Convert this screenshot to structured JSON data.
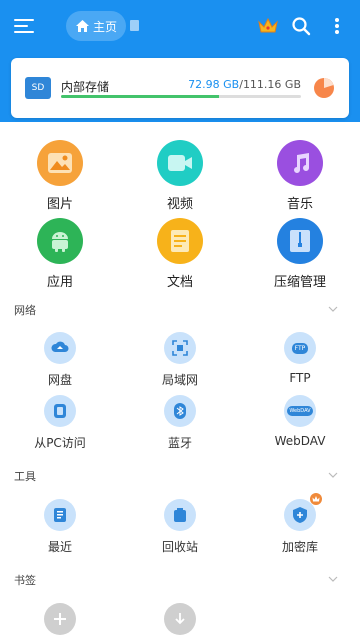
{
  "header": {
    "home_label": "主页"
  },
  "storage": {
    "name": "内部存储",
    "sd_label": "SD",
    "used": "72.98 GB",
    "separator": "/",
    "total": "111.16 GB",
    "used_fraction": 0.66
  },
  "categories": [
    {
      "label": "图片",
      "icon": "image-icon",
      "color": "#f6a23a"
    },
    {
      "label": "视频",
      "icon": "video-icon",
      "color": "#20cdc4"
    },
    {
      "label": "音乐",
      "icon": "music-icon",
      "color": "#9a4fe0"
    },
    {
      "label": "应用",
      "icon": "android-icon",
      "color": "#2db457"
    },
    {
      "label": "文档",
      "icon": "document-icon",
      "color": "#f7b21a"
    },
    {
      "label": "压缩管理",
      "icon": "archive-icon",
      "color": "#2481e0"
    }
  ],
  "sections": {
    "network": {
      "title": "网络",
      "items": [
        {
          "label": "网盘",
          "icon": "cloud-drive-icon"
        },
        {
          "label": "局域网",
          "icon": "lan-icon"
        },
        {
          "label": "FTP",
          "icon": "ftp-icon"
        },
        {
          "label": "从PC访问",
          "icon": "pc-access-icon"
        },
        {
          "label": "蓝牙",
          "icon": "bluetooth-icon"
        },
        {
          "label": "WebDAV",
          "icon": "webdav-icon"
        }
      ]
    },
    "tools": {
      "title": "工具",
      "items": [
        {
          "label": "最近",
          "icon": "recent-icon"
        },
        {
          "label": "回收站",
          "icon": "recycle-bin-icon"
        },
        {
          "label": "加密库",
          "icon": "encrypted-vault-icon"
        }
      ]
    },
    "bookmarks": {
      "title": "书签",
      "items": [
        {
          "label": "",
          "icon": "add-icon"
        },
        {
          "label": "",
          "icon": "download-icon"
        }
      ]
    }
  },
  "icon_text": {
    "ftp": "FTP",
    "webdav": "WebDAV"
  }
}
